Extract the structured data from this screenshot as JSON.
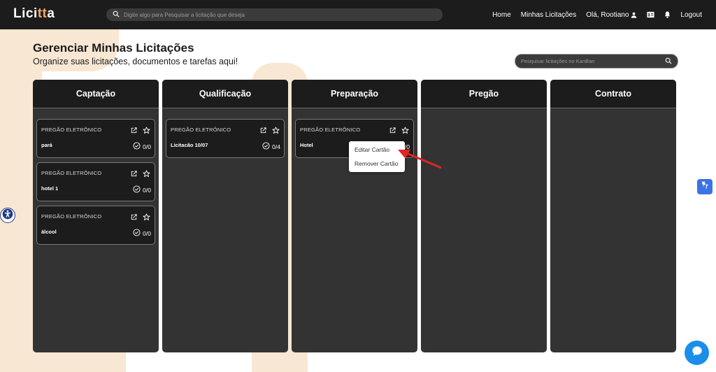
{
  "app": {
    "logo_prefix": "Lici",
    "logo_accent": "tt",
    "logo_suffix": "a"
  },
  "topbar": {
    "search_placeholder": "Digite algo para Pesquisar a licitação que deseja",
    "nav": {
      "home": "Home",
      "my_bids": "Minhas Licitações",
      "greeting": "Olá, Rootiano",
      "logout": "Logout"
    }
  },
  "page": {
    "title": "Gerenciar Minhas Licitações",
    "subtitle": "Organize suas licitações, documentos e tarefas aqui!",
    "kanban_search_placeholder": "Pesquisar licitações no KanBan"
  },
  "columns": [
    {
      "title": "Captação",
      "cards": [
        {
          "type": "PREGÃO ELETRÔNICO",
          "name": "pará",
          "progress": "0/0"
        },
        {
          "type": "PREGÃO ELETRÔNICO",
          "name": "hotel 1",
          "progress": "0/0"
        },
        {
          "type": "PREGÃO ELETRÔNICO",
          "name": "álcool",
          "progress": "0/0"
        }
      ]
    },
    {
      "title": "Qualificação",
      "cards": [
        {
          "type": "PREGÃO ELETRÔNICO",
          "name": "Licitacão 10/07",
          "progress": "0/4"
        }
      ]
    },
    {
      "title": "Preparação",
      "cards": [
        {
          "type": "PREGÃO ELETRÔNICO",
          "name": "Hotel",
          "progress": "0/0"
        }
      ]
    },
    {
      "title": "Pregão",
      "cards": []
    },
    {
      "title": "Contrato",
      "cards": []
    }
  ],
  "context_menu": {
    "edit": "Editar Cartão",
    "remove": "Remover Cartão"
  },
  "colors": {
    "topbar": "#1c1c1c",
    "column": "#333333",
    "accent": "#f3a55d",
    "arrow": "#e02424",
    "chat": "#1a8ee8"
  },
  "icons": [
    "search-icon",
    "user-icon",
    "id-card-icon",
    "bell-icon",
    "external-link-icon",
    "star-icon",
    "check-circle-icon",
    "accessibility-icon",
    "translate-icon",
    "chat-icon"
  ]
}
